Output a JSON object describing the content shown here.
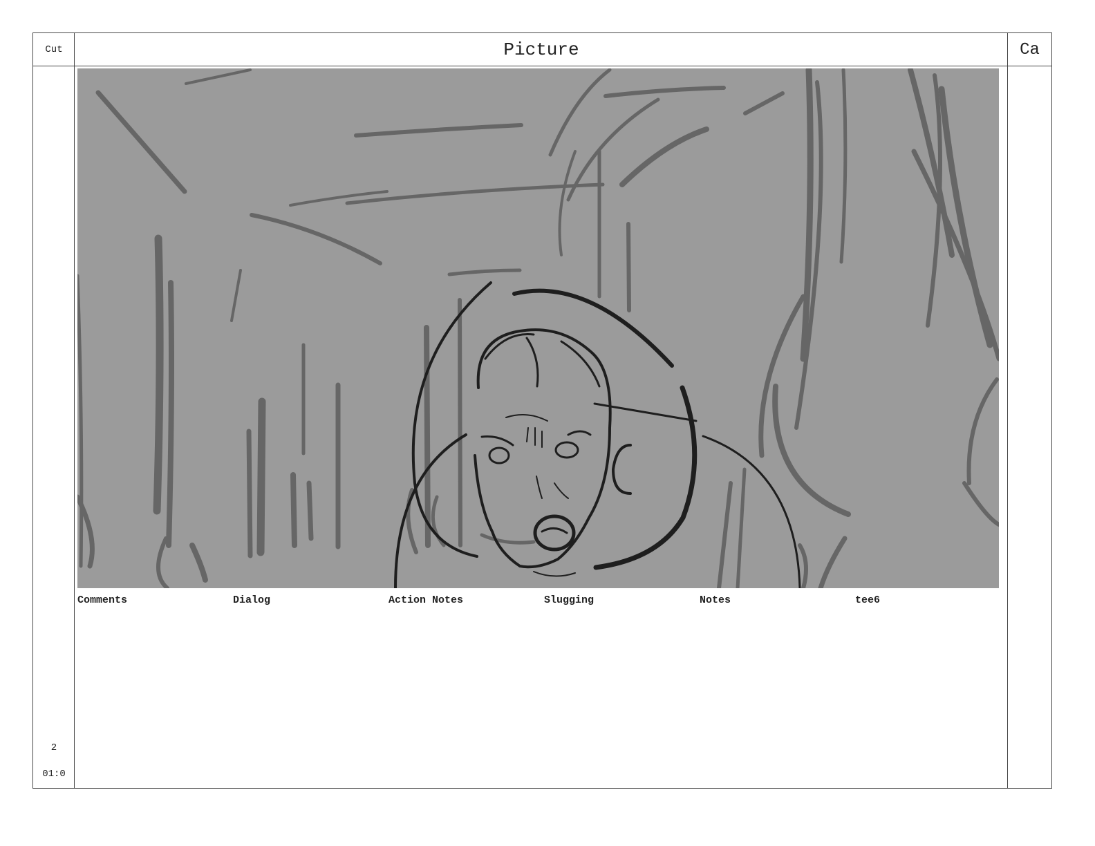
{
  "header": {
    "cut_label": "Cut",
    "picture_label": "Picture",
    "camera_label": "Ca"
  },
  "fields": [
    {
      "label": "Comments"
    },
    {
      "label": "Dialog"
    },
    {
      "label": "Action Notes"
    },
    {
      "label": "Slugging"
    },
    {
      "label": "Notes"
    },
    {
      "label": "tee6"
    }
  ],
  "cut": {
    "number": "2",
    "duration": "01:0"
  },
  "colors": {
    "panel_background": "#9b9b9b",
    "background_strokes": "#666666",
    "character_strokes": "#1e1e1e",
    "border": "#444444"
  }
}
